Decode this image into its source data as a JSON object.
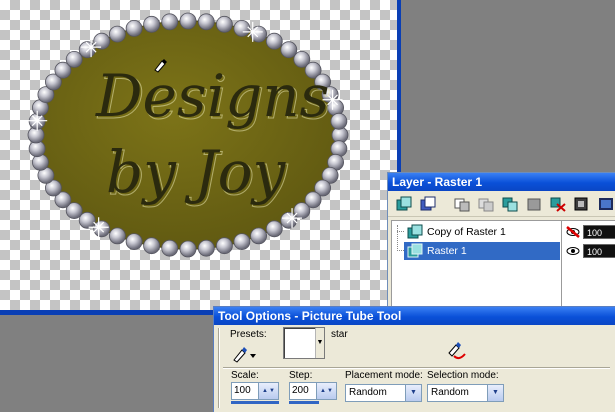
{
  "canvas": {
    "logo_line1": "Designs",
    "logo_line2": "by Joy",
    "oval_color": "#6e6614",
    "bead_color": "#b8b8c4"
  },
  "layer_palette": {
    "title": "Layer - Raster 1",
    "toolbar_icons": [
      "new-raster-layer-icon",
      "new-vector-layer-icon",
      "new-mask-layer-icon",
      "new-adjustment-layer-icon",
      "duplicate-layer-icon",
      "merge-layer-icon",
      "delete-layer-icon",
      "load-mask-icon",
      "layer-properties-icon"
    ],
    "layers": [
      {
        "name": "Copy of Raster 1",
        "opacity": "100",
        "selected": false,
        "visible": true
      },
      {
        "name": "Raster 1",
        "opacity": "100",
        "selected": true,
        "visible": true
      }
    ]
  },
  "tool_options": {
    "title": "Tool Options - Picture Tube Tool",
    "presets_label": "Presets:",
    "tube_name": "star",
    "scale_label": "Scale:",
    "scale_value": "100",
    "step_label": "Step:",
    "step_value": "200",
    "placement_label": "Placement mode:",
    "placement_value": "Random",
    "selection_label": "Selection mode:",
    "selection_value": "Random"
  }
}
